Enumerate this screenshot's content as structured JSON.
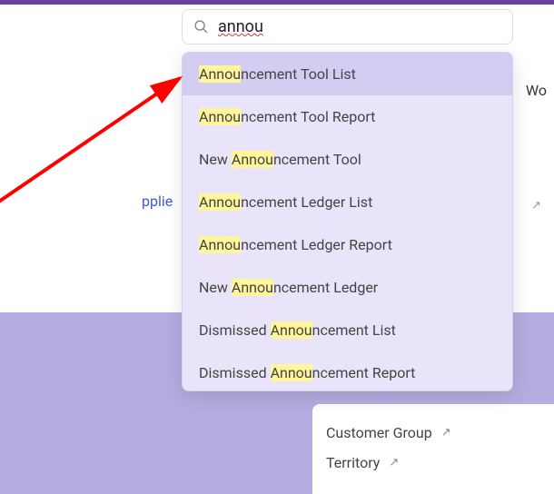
{
  "search": {
    "placeholder": "",
    "value": "annou",
    "suggestions": [
      {
        "parts": [
          "Annou",
          "ncement Tool List"
        ],
        "highlighted": true,
        "hlmask": [
          true,
          false
        ]
      },
      {
        "parts": [
          "Annou",
          "ncement Tool Report"
        ],
        "highlighted": false,
        "hlmask": [
          true,
          false
        ]
      },
      {
        "parts": [
          "New ",
          "Annou",
          "ncement Tool"
        ],
        "highlighted": false,
        "hlmask": [
          false,
          true,
          false
        ]
      },
      {
        "parts": [
          "Annou",
          "ncement Ledger List"
        ],
        "highlighted": false,
        "hlmask": [
          true,
          false
        ]
      },
      {
        "parts": [
          "Annou",
          "ncement Ledger Report"
        ],
        "highlighted": false,
        "hlmask": [
          true,
          false
        ]
      },
      {
        "parts": [
          "New ",
          "Annou",
          "ncement Ledger"
        ],
        "highlighted": false,
        "hlmask": [
          false,
          true,
          false
        ]
      },
      {
        "parts": [
          "Dismissed ",
          "Annou",
          "ncement List"
        ],
        "highlighted": false,
        "hlmask": [
          false,
          true,
          false
        ]
      },
      {
        "parts": [
          "Dismissed ",
          "Annou",
          "ncement Report"
        ],
        "highlighted": false,
        "hlmask": [
          false,
          true,
          false
        ]
      }
    ]
  },
  "background": {
    "supplier_text": "pplie",
    "wo_text": "Wo",
    "links": [
      {
        "label": "Customer Group"
      },
      {
        "label": "Territory"
      }
    ]
  }
}
